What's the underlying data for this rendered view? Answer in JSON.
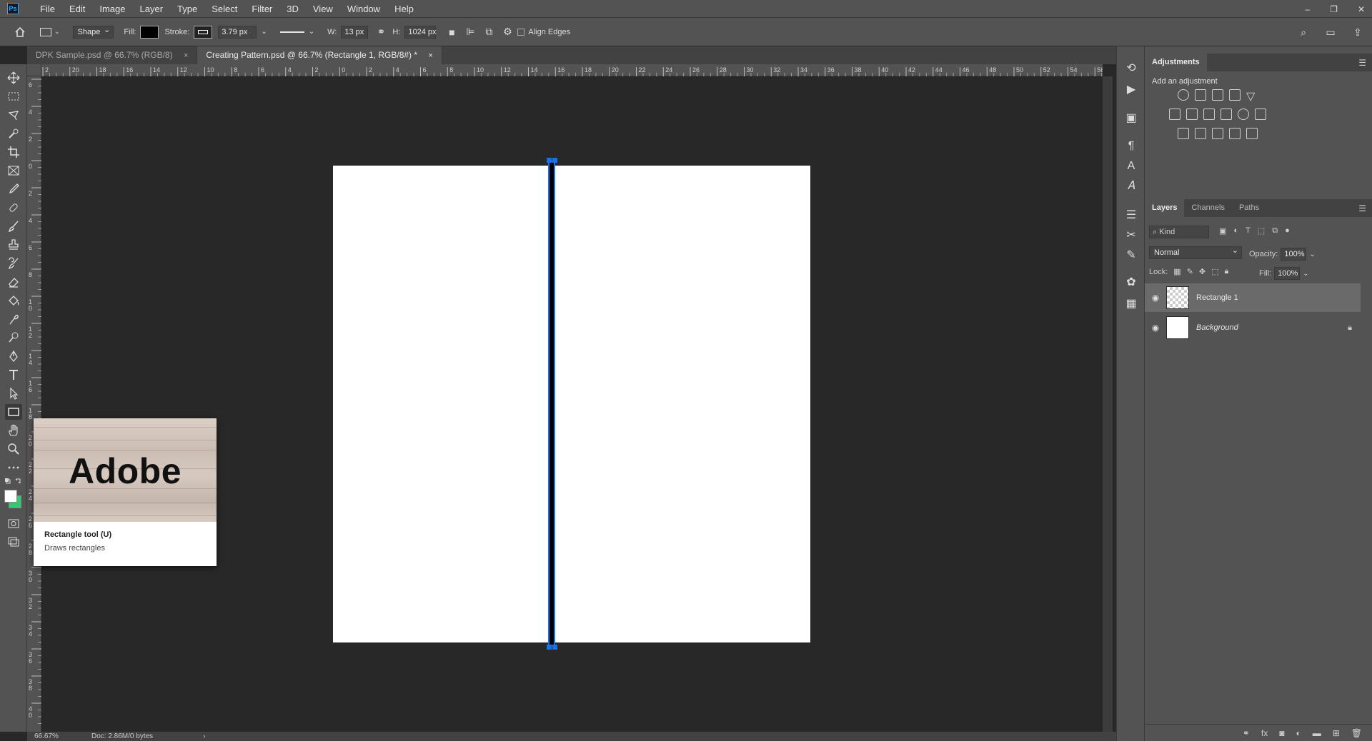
{
  "app": {
    "logo": "Ps",
    "menu": [
      "File",
      "Edit",
      "Image",
      "Layer",
      "Type",
      "Select",
      "Filter",
      "3D",
      "View",
      "Window",
      "Help"
    ],
    "window_controls": [
      "–",
      "❐",
      "✕"
    ]
  },
  "options_bar": {
    "mode": "Shape",
    "fill_label": "Fill:",
    "stroke_label": "Stroke:",
    "stroke_width": "3.79 px",
    "w_label": "W:",
    "w_value": "13 px",
    "h_label": "H:",
    "h_value": "1024 px",
    "align_edges": "Align Edges"
  },
  "tabs": [
    {
      "label": "DPK Sample.psd @ 66.7% (RGB/8)",
      "close": "×",
      "active": false
    },
    {
      "label": "Creating Pattern.psd @ 66.7% (Rectangle 1, RGB/8#) *",
      "close": "×",
      "active": true
    }
  ],
  "ruler": {
    "h_ticks": [
      "2",
      "20",
      "18",
      "16",
      "14",
      "12",
      "10",
      "8",
      "6",
      "4",
      "2",
      "0",
      "2",
      "4",
      "6",
      "8",
      "10",
      "12",
      "14",
      "16",
      "18",
      "20",
      "22",
      "24",
      "26",
      "28",
      "30",
      "32",
      "34",
      "36",
      "38",
      "40",
      "42",
      "44",
      "46",
      "48",
      "50",
      "52",
      "54",
      "56"
    ],
    "v_ticks": [
      "6",
      "4",
      "2",
      "0",
      "2",
      "4",
      "6",
      "8",
      "10",
      "12",
      "14",
      "16",
      "18",
      "20",
      "22",
      "24",
      "26",
      "28",
      "30",
      "32",
      "34",
      "36",
      "38",
      "40"
    ]
  },
  "tooltip": {
    "image_word": "Adobe",
    "title": "Rectangle tool (U)",
    "description": "Draws rectangles"
  },
  "status": {
    "zoom": "66.67%",
    "doc": "Doc: 2.86M/0 bytes",
    "arrow": "›"
  },
  "adjustments": {
    "tab": "Adjustments",
    "subtitle": "Add an adjustment"
  },
  "layers_panel": {
    "tabs": [
      "Layers",
      "Channels",
      "Paths"
    ],
    "filter_kind": "Kind",
    "blend_mode": "Normal",
    "opacity_label": "Opacity:",
    "opacity": "100%",
    "lock_label": "Lock:",
    "fill_label": "Fill:",
    "fill": "100%",
    "layers": [
      {
        "name": "Rectangle 1",
        "selected": true,
        "locked": false
      },
      {
        "name": "Background",
        "selected": false,
        "locked": true
      }
    ]
  },
  "colors": {
    "selection_blue": "#1473e6",
    "background_swatch": "#2ecc71",
    "foreground_swatch": "#ffffff"
  }
}
